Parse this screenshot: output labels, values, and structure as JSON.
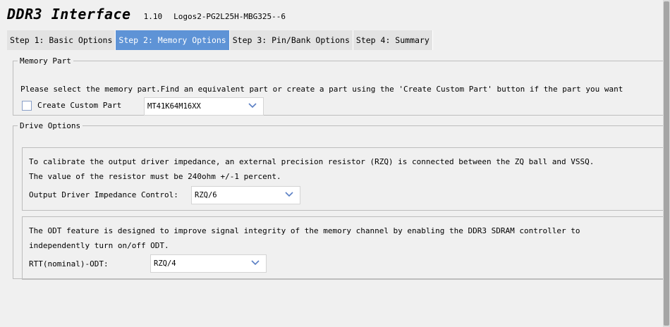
{
  "header": {
    "title": "DDR3 Interface",
    "version": "1.10",
    "device": "Logos2-PG2L25H-MBG325--6"
  },
  "tabs": [
    {
      "label": "Step 1: Basic Options",
      "active": false
    },
    {
      "label": "Step 2: Memory Options",
      "active": true
    },
    {
      "label": "Step 3: Pin/Bank Options",
      "active": false
    },
    {
      "label": "Step 4: Summary",
      "active": false
    }
  ],
  "memory_part": {
    "legend": "Memory Part",
    "description": "Please select the memory part.Find an equivalent part or create a part using the 'Create Custom Part' button if the part you want",
    "custom_checkbox_label": "Create Custom Part",
    "custom_checked": false,
    "part_value": "MT41K64M16XX"
  },
  "drive_options": {
    "legend": "Drive Options",
    "impedance": {
      "line1": "To calibrate the output driver impedance, an external precision resistor (RZQ) is connected between the ZQ ball and VSSQ.",
      "line2": "The value of the resistor must be 240ohm +/-1 percent.",
      "label": "Output Driver Impedance Control:",
      "value": "RZQ/6"
    },
    "odt": {
      "line1": "The ODT feature is designed to improve signal integrity of the memory channel by enabling the DDR3 SDRAM controller to",
      "line2": "independently turn on/off ODT.",
      "label": "RTT(nominal)-ODT:",
      "value": "RZQ/4"
    }
  },
  "colors": {
    "active_tab": "#5e93d6",
    "chevron": "#5a7fc4"
  }
}
